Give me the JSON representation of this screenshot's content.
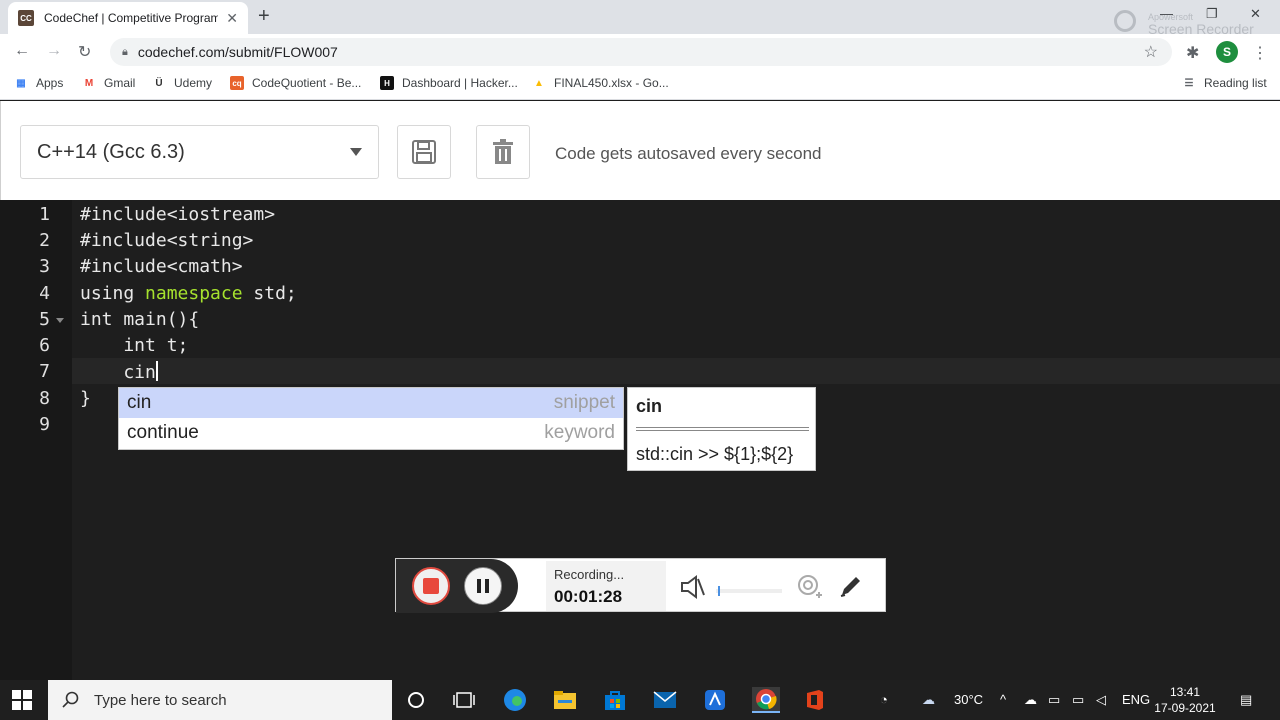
{
  "browser": {
    "tab_title": "CodeChef | Competitive Programm",
    "favicon_text": "CC",
    "url": "codechef.com/submit/FLOW007",
    "watermark_line1": "Apowersoft",
    "watermark_line2": "Screen Recorder",
    "bookmarks": [
      "Apps",
      "Gmail",
      "Udemy",
      "CodeQuotient - Be...",
      "Dashboard | Hacker...",
      "FINAL450.xlsx - Go..."
    ],
    "reading_list": "Reading list",
    "profile_initial": "S"
  },
  "editor_header": {
    "language": "C++14 (Gcc 6.3)",
    "autosave_text": "Code gets autosaved every second"
  },
  "code": {
    "line_numbers": [
      "1",
      "2",
      "3",
      "4",
      "5",
      "6",
      "7",
      "8",
      "9"
    ],
    "lines": {
      "l1": "#include<iostream>",
      "l2": "#include<string>",
      "l3": "#include<cmath>",
      "l4_a": "using ",
      "l4_b": "namespace",
      "l4_c": " std;",
      "l5": "int main(){",
      "l6": "    int t;",
      "l7": "    cin",
      "l8": "}"
    }
  },
  "autocomplete": {
    "items": [
      {
        "label": "cin",
        "meta": "snippet"
      },
      {
        "label": "continue",
        "meta": "keyword"
      }
    ],
    "doc_title": "cin",
    "doc_body": "std::cin >> ${1};${2}"
  },
  "recorder": {
    "status": "Recording...",
    "time": "00:01:28",
    "volume": 0.03
  },
  "taskbar": {
    "search_placeholder": "Type here to search",
    "temperature": "30°C",
    "language": "ENG",
    "time": "13:41",
    "date": "17-09-2021"
  }
}
